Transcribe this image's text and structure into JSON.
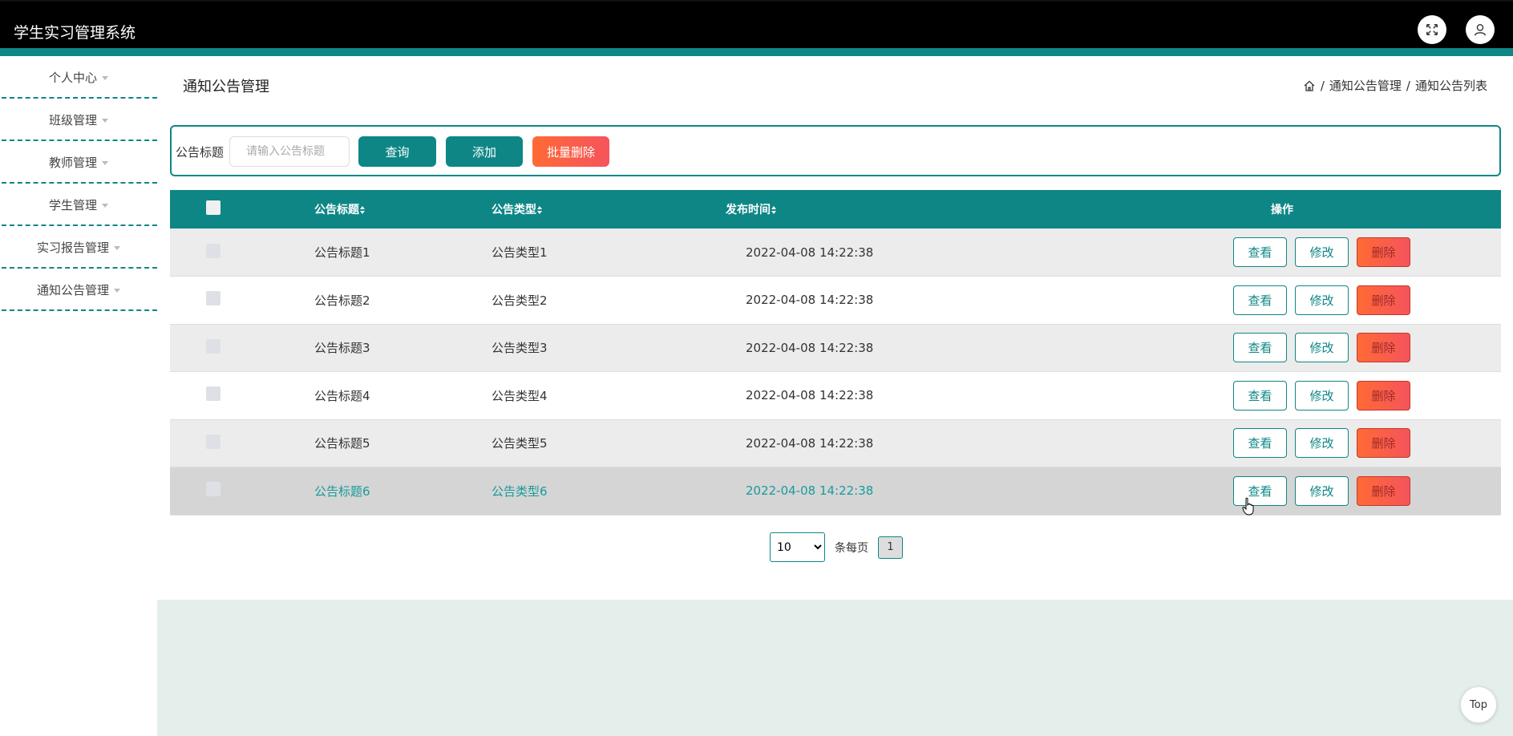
{
  "app": {
    "title": "学生实习管理系统",
    "fullscreen_icon": "expand-icon",
    "user_icon": "user-icon",
    "accent_color": "#0e8686",
    "danger_color": "#f5545c"
  },
  "sidebar": {
    "items": [
      {
        "label": "个人中心"
      },
      {
        "label": "班级管理"
      },
      {
        "label": "教师管理"
      },
      {
        "label": "学生管理"
      },
      {
        "label": "实习报告管理"
      },
      {
        "label": "通知公告管理"
      }
    ]
  },
  "page": {
    "title": "通知公告管理",
    "breadcrumb": [
      "通知公告管理",
      "通知公告列表"
    ],
    "breadcrumb_sep": "/"
  },
  "search": {
    "label": "公告标题",
    "placeholder": "请输入公告标题",
    "value": "",
    "query_label": "查询",
    "add_label": "添加",
    "batch_delete_label": "批量删除"
  },
  "table": {
    "headers": {
      "title": "公告标题",
      "type": "公告类型",
      "time": "发布时间",
      "ops": "操作"
    },
    "rows": [
      {
        "title": "公告标题1",
        "type": "公告类型1",
        "time": "2022-04-08 14:22:38"
      },
      {
        "title": "公告标题2",
        "type": "公告类型2",
        "time": "2022-04-08 14:22:38"
      },
      {
        "title": "公告标题3",
        "type": "公告类型3",
        "time": "2022-04-08 14:22:38"
      },
      {
        "title": "公告标题4",
        "type": "公告类型4",
        "time": "2022-04-08 14:22:38"
      },
      {
        "title": "公告标题5",
        "type": "公告类型5",
        "time": "2022-04-08 14:22:38"
      },
      {
        "title": "公告标题6",
        "type": "公告类型6",
        "time": "2022-04-08 14:22:38"
      }
    ],
    "actions": {
      "view": "查看",
      "edit": "修改",
      "delete": "删除"
    }
  },
  "pagination": {
    "page_size": "10",
    "page_size_options": [
      "10"
    ],
    "per_page_label": "条每页",
    "current_page": "1"
  },
  "back_to_top": {
    "label": "Top"
  }
}
